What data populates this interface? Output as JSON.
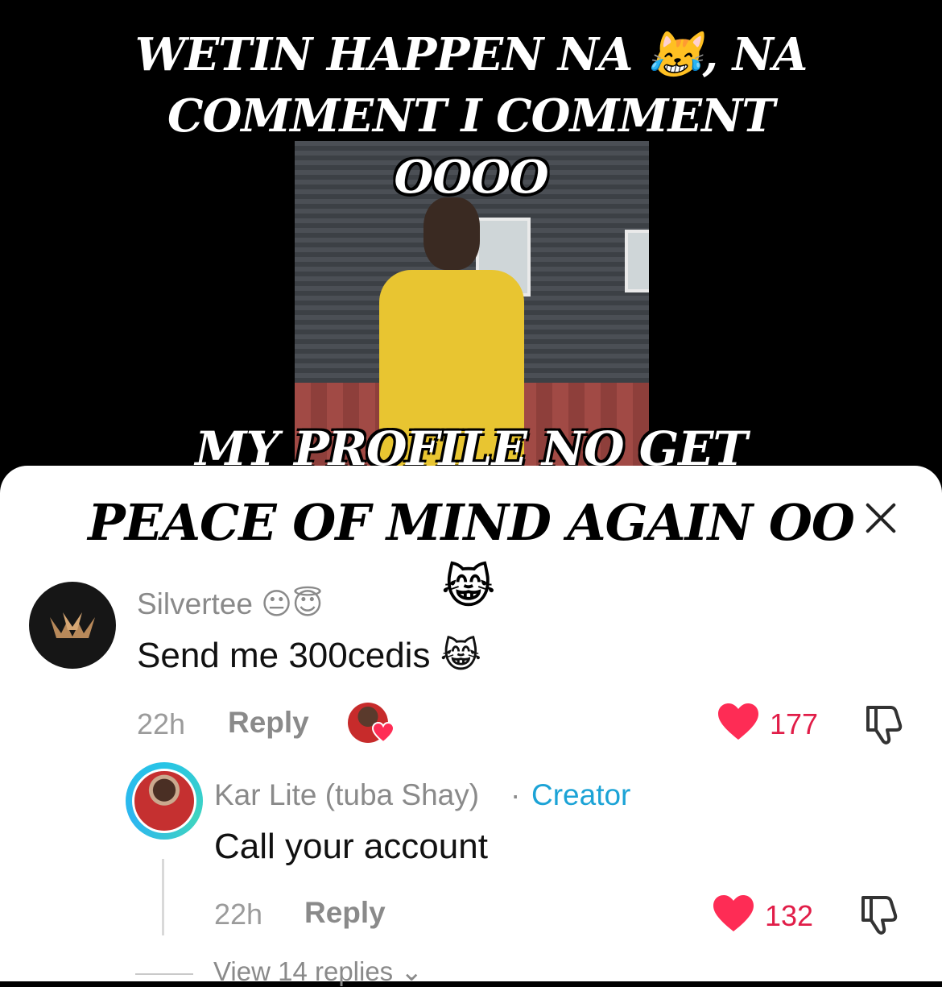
{
  "video": {
    "caption_top": [
      "WETIN HAPPEN NA 😹, NA",
      "COMMENT I COMMENT",
      "OOOO"
    ],
    "caption_bottom_line1": "MY PROFILE NO GET",
    "caption_bottom_line2": "PEACE OF MIND AGAIN OO",
    "caption_emoji": "😹"
  },
  "comments": [
    {
      "username": "Silvertee 😐😇",
      "text": "Send me 300cedis 😹",
      "time": "22h",
      "reply_label": "Reply",
      "likes": "177",
      "liked_by_creator": true
    }
  ],
  "reply": {
    "username": "Kar Lite (tuba Shay)",
    "separator": "·",
    "badge": "Creator",
    "text": "Call your account",
    "time": "22h",
    "reply_label": "Reply",
    "likes": "132"
  },
  "view_replies": "View 14 replies ⌄",
  "colors": {
    "like": "#e11d48",
    "creator": "#1ca3d6",
    "muted": "#8a8a8a"
  }
}
